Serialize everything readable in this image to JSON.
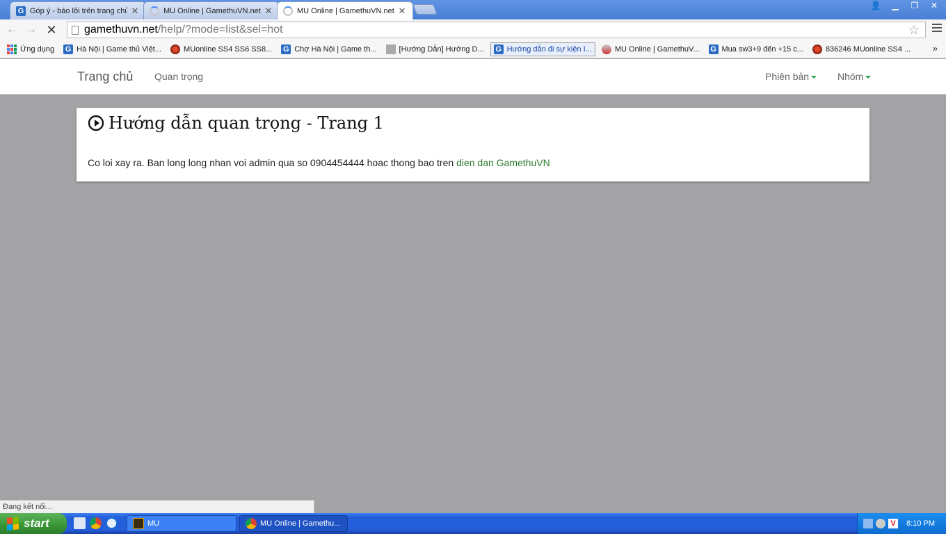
{
  "browser": {
    "tabs": [
      {
        "title": "Góp ý - báo lỗi trên trang chủ",
        "icon": "gamethuvn-icon",
        "active": false
      },
      {
        "title": "MU Online | GamethuVN.net",
        "icon": "loading-spinner-icon",
        "active": false
      },
      {
        "title": "MU Online | GamethuVN.net",
        "icon": "loading-spinner-icon",
        "active": true
      }
    ],
    "url_host": "gamethuvn.net",
    "url_path": "/help/?mode=list&sel=hot",
    "bookmarks": [
      {
        "label": "Ứng dụng",
        "icon": "apps-icon"
      },
      {
        "label": "Hà Nội | Game thủ Việt...",
        "icon": "gamethuvn-icon"
      },
      {
        "label": "MUonline SS4 SS6 SS8...",
        "icon": "mu-red-icon"
      },
      {
        "label": "Chợ Hà Nội | Game th...",
        "icon": "gamethuvn-icon"
      },
      {
        "label": "[Hướng Dẫn] Hướng D...",
        "icon": "mu-logo-icon"
      },
      {
        "label": "Hướng dẫn đi sự kiện I...",
        "icon": "gamethuvn-icon",
        "active": true
      },
      {
        "label": "MU Online | GamethuV...",
        "icon": "character-icon"
      },
      {
        "label": "Mua sw3+9 đến +15 c...",
        "icon": "gamethuvn-icon"
      },
      {
        "label": "836246 MUonline SS4 ...",
        "icon": "mu-red-icon"
      }
    ],
    "bookmarks_more": "»",
    "status_text": "Đang kết nối..."
  },
  "site": {
    "brand": "Trang chủ",
    "nav_links": [
      "Quan trọng"
    ],
    "right_menus": [
      "Phiên bản",
      "Nhóm"
    ],
    "accent_color": "#2aa24a"
  },
  "content": {
    "heading": "Hướng dẫn quan trọng - Trang 1",
    "message": "Co loi xay ra. Ban long long nhan voi admin qua so 0904454444 hoac thong bao tren",
    "link_text": "dien dan GamethuVN"
  },
  "taskbar": {
    "start_label": "start",
    "items": [
      {
        "label": "MU",
        "icon": "mu-game-icon"
      },
      {
        "label": "MU Online | Gamethu...",
        "icon": "chrome-icon"
      }
    ],
    "clock": "8:10 PM"
  }
}
